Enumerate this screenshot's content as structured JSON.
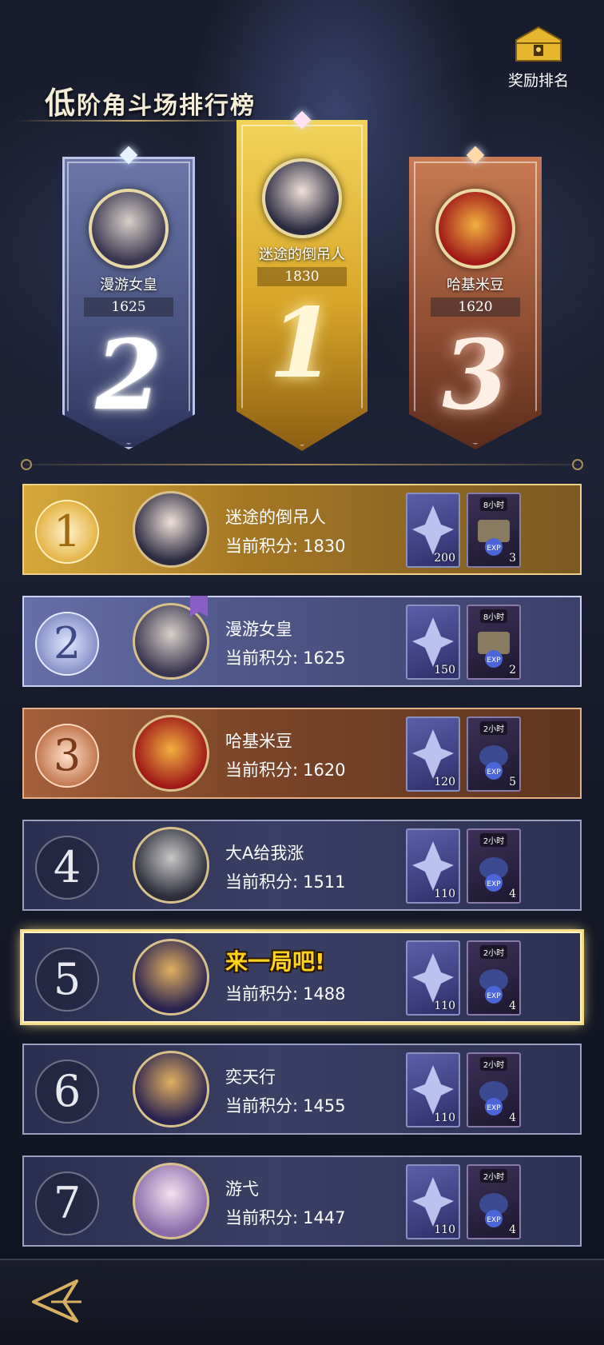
{
  "header": {
    "title_first": "低",
    "title_rest": "阶角斗场排行榜",
    "reward_label": "奖励排名"
  },
  "podium": [
    {
      "rank": "2",
      "name": "漫游女皇",
      "score": "1625"
    },
    {
      "rank": "1",
      "name": "迷途的倒吊人",
      "score": "1830"
    },
    {
      "rank": "3",
      "name": "哈基米豆",
      "score": "1620"
    }
  ],
  "score_label": "当前积分:",
  "rows": [
    {
      "rank": "1",
      "name": "迷途的倒吊人",
      "score": "1830",
      "gem_qty": "200",
      "chest_tag": "8小时",
      "chest_qty": "3"
    },
    {
      "rank": "2",
      "name": "漫游女皇",
      "score": "1625",
      "gem_qty": "150",
      "chest_tag": "8小时",
      "chest_qty": "2"
    },
    {
      "rank": "3",
      "name": "哈基米豆",
      "score": "1620",
      "gem_qty": "120",
      "chest_tag": "2小时",
      "chest_qty": "5"
    },
    {
      "rank": "4",
      "name": "大A给我涨",
      "score": "1511",
      "gem_qty": "110",
      "chest_tag": "2小时",
      "chest_qty": "4"
    },
    {
      "rank": "5",
      "name": "来一局吧!",
      "score": "1488",
      "gem_qty": "110",
      "chest_tag": "2小时",
      "chest_qty": "4"
    },
    {
      "rank": "6",
      "name": "奕天行",
      "score": "1455",
      "gem_qty": "110",
      "chest_tag": "2小时",
      "chest_qty": "4"
    },
    {
      "rank": "7",
      "name": "游弋",
      "score": "1447",
      "gem_qty": "110",
      "chest_tag": "2小时",
      "chest_qty": "4"
    }
  ],
  "colors": {
    "gold": "#d6a93c",
    "silver": "#6670a8",
    "bronze": "#a5603c",
    "row": "#2f3456",
    "highlight": "#f4dc8a",
    "taunt": "#ffd21a"
  },
  "icons": [
    "chest-icon",
    "gem-icon",
    "exp-chest-icon",
    "back-arrow-icon",
    "bookmark-icon"
  ]
}
